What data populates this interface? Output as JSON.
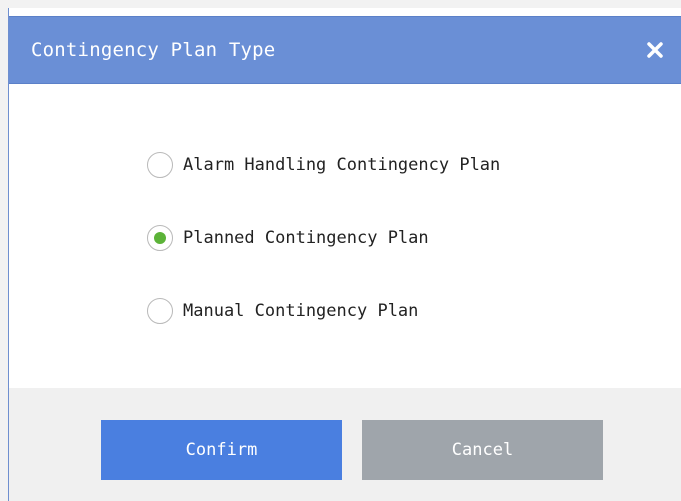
{
  "dialog": {
    "title": "Contingency Plan Type",
    "close_icon": "close-icon"
  },
  "options": [
    {
      "label": "Alarm Handling Contingency Plan",
      "checked": false
    },
    {
      "label": "Planned Contingency Plan",
      "checked": true
    },
    {
      "label": "Manual Contingency Plan",
      "checked": false
    }
  ],
  "buttons": {
    "confirm_label": "Confirm",
    "cancel_label": "Cancel"
  },
  "colors": {
    "title_bar": "#6a8fd6",
    "confirm": "#4a7fe0",
    "cancel": "#9fa5ab",
    "radio_checked": "#5cb338"
  }
}
